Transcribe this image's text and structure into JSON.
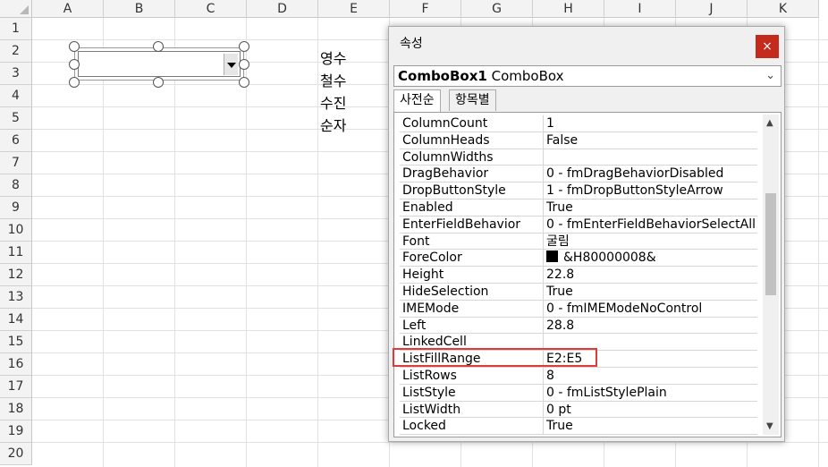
{
  "sheet": {
    "columns": [
      "A",
      "B",
      "C",
      "D",
      "E",
      "F",
      "G",
      "H",
      "I",
      "J",
      "K"
    ],
    "rows": [
      "1",
      "2",
      "3",
      "4",
      "5",
      "6",
      "7",
      "8",
      "9",
      "10",
      "11",
      "12",
      "13",
      "14",
      "15",
      "16",
      "17",
      "18",
      "19",
      "20"
    ],
    "e_column_values": [
      "영수",
      "철수",
      "수진",
      "순자"
    ]
  },
  "properties_window": {
    "title": "속성",
    "close_label": "×",
    "object_name": "ComboBox1",
    "object_type": "ComboBox",
    "tabs": [
      "사전순",
      "항목별"
    ],
    "active_tab": "사전순",
    "properties": [
      {
        "name": "ColumnCount",
        "value": "1"
      },
      {
        "name": "ColumnHeads",
        "value": "False"
      },
      {
        "name": "ColumnWidths",
        "value": ""
      },
      {
        "name": "DragBehavior",
        "value": "0 - fmDragBehaviorDisabled"
      },
      {
        "name": "DropButtonStyle",
        "value": "1 - fmDropButtonStyleArrow"
      },
      {
        "name": "Enabled",
        "value": "True"
      },
      {
        "name": "EnterFieldBehavior",
        "value": "0 - fmEnterFieldBehaviorSelectAll"
      },
      {
        "name": "Font",
        "value": "굴림"
      },
      {
        "name": "ForeColor",
        "value": "&H80000008&"
      },
      {
        "name": "Height",
        "value": "22.8"
      },
      {
        "name": "HideSelection",
        "value": "True"
      },
      {
        "name": "IMEMode",
        "value": "0 - fmIMEModeNoControl"
      },
      {
        "name": "Left",
        "value": "28.8"
      },
      {
        "name": "LinkedCell",
        "value": ""
      },
      {
        "name": "ListFillRange",
        "value": "E2:E5"
      },
      {
        "name": "ListRows",
        "value": "8"
      },
      {
        "name": "ListStyle",
        "value": "0 - fmListStylePlain"
      },
      {
        "name": "ListWidth",
        "value": "0 pt"
      },
      {
        "name": "Locked",
        "value": "True"
      }
    ],
    "highlighted_property": "ListFillRange",
    "forecolor_swatch": "#000000",
    "highlight_color": "#e03b3b"
  }
}
